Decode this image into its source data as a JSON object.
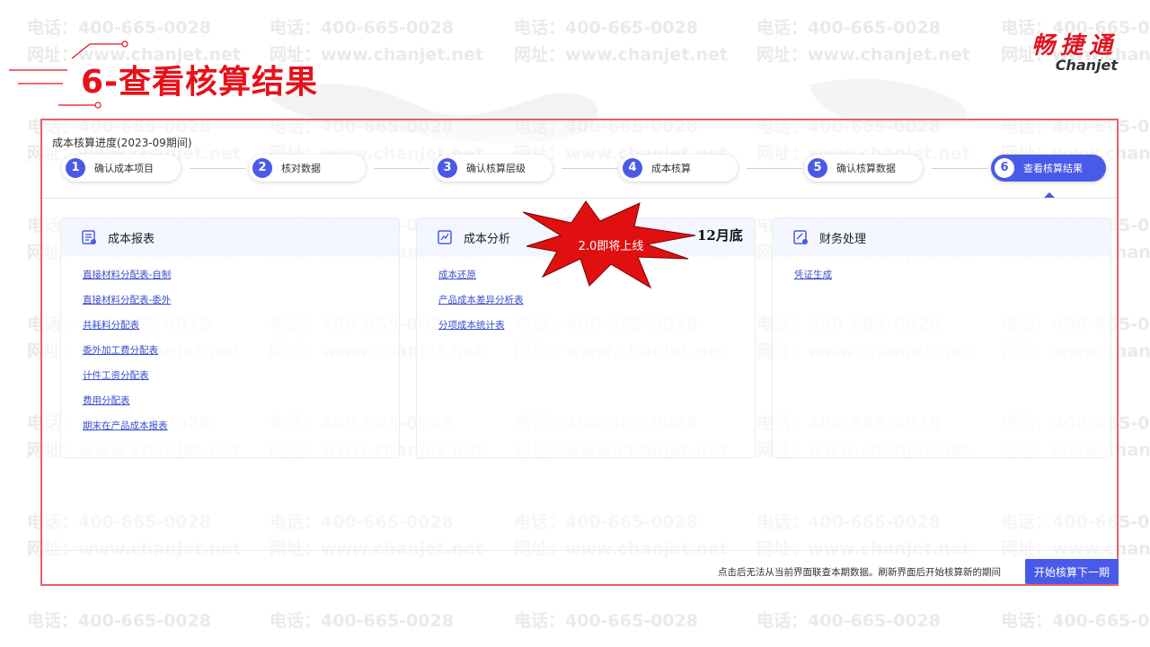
{
  "slide": {
    "title": "6-查看核算结果"
  },
  "logo": {
    "cn": "畅捷通",
    "en": "Chanjet"
  },
  "watermark": {
    "phone": "电话：400-665-0028",
    "site": "网址：www.chanjet.net"
  },
  "progress": {
    "title": "成本核算进度(2023-09期间)",
    "steps": [
      {
        "num": "1",
        "label": "确认成本项目"
      },
      {
        "num": "2",
        "label": "核对数据"
      },
      {
        "num": "3",
        "label": "确认核算层级"
      },
      {
        "num": "4",
        "label": "成本核算"
      },
      {
        "num": "5",
        "label": "确认核算数据"
      },
      {
        "num": "6",
        "label": "查看核算结果"
      }
    ],
    "active_step": 6
  },
  "cards": [
    {
      "title": "成本报表",
      "links": [
        "直接材料分配表-自制",
        "直接材料分配表-委外",
        "共耗料分配表",
        "委外加工费分配表",
        "计件工资分配表",
        "费用分配表",
        "期末在产品成本报表"
      ]
    },
    {
      "title": "成本分析",
      "links": [
        "成本还原",
        "产品成本差异分析表",
        "分项成本统计表"
      ]
    },
    {
      "title": "财务处理",
      "links": [
        "凭证生成"
      ]
    }
  ],
  "callout": {
    "burst_text": "2.0即将上线",
    "month_note": "12月底"
  },
  "footer": {
    "hint": "点击后无法从当前界面联查本期数据。刷新界面后开始核算新的期间",
    "button": "开始核算下一期"
  },
  "colors": {
    "accent": "#4a5ae8",
    "title_red": "#e8101a",
    "frame_border": "#e8606a",
    "burst": "#e01010"
  }
}
